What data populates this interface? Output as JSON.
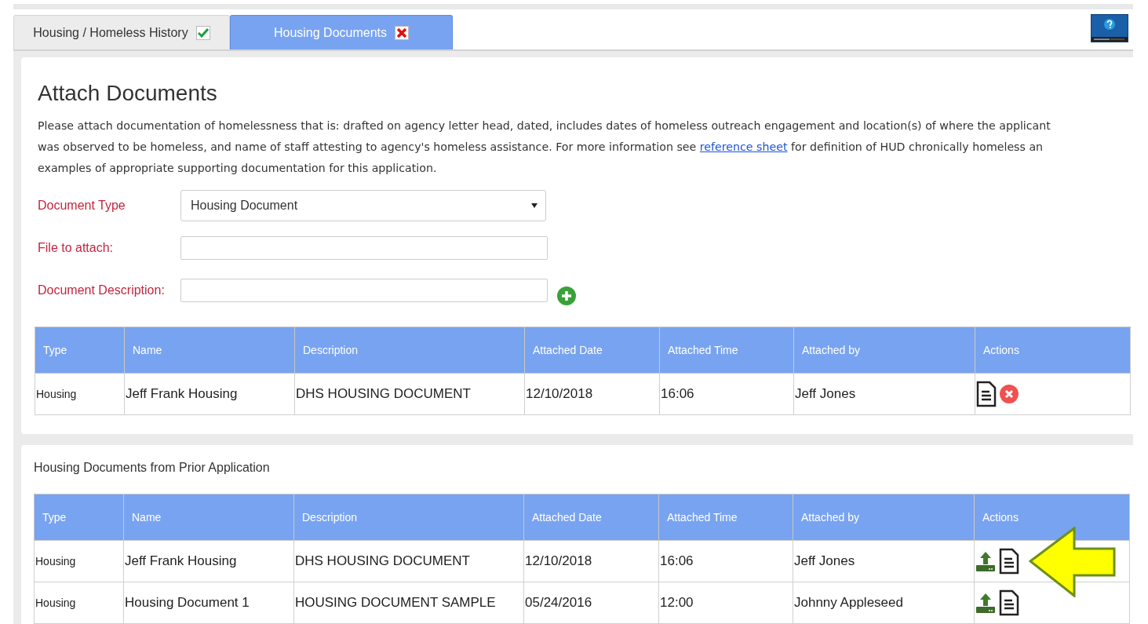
{
  "tabs": [
    {
      "label": "Housing / Homeless History",
      "selected": false,
      "complete": true
    },
    {
      "label": "Housing Documents",
      "selected": true,
      "complete": false
    }
  ],
  "attach": {
    "title": "Attach Documents",
    "intro_lines": [
      {
        "before": "Please attach documentation of homelessness that is: drafted on agency letter head, dated, includes dates of homeless outreach engagement and location(s) of where the applicant"
      },
      {
        "before": "was observed to be homeless, and name of staff attesting to agency's homeless assistance. For more information see ",
        "link": "reference sheet",
        "after": " for definition of HUD chronically homeless an"
      },
      {
        "before": "examples of appropriate supporting documentation for this application."
      }
    ],
    "form": [
      {
        "kind": "select",
        "label": "Document Type",
        "value": "Housing Document"
      },
      {
        "kind": "text",
        "label": "File to attach:"
      },
      {
        "kind": "add",
        "label": "Document Description:"
      }
    ],
    "table": {
      "columns": [
        "Type",
        "Name",
        "Description",
        "Attached Date",
        "Attached Time",
        "Attached by",
        "Actions"
      ],
      "rows": [
        {
          "cells": [
            "Housing",
            "Jeff Frank Housing",
            "DHS HOUSING DOCUMENT",
            "12/10/2018",
            "16:06",
            "Jeff Jones"
          ],
          "actions": [
            {
              "kind": "view"
            },
            {
              "kind": "delete"
            }
          ]
        }
      ]
    }
  },
  "prior": {
    "title": "Housing Documents from Prior Application",
    "table": {
      "columns": [
        "Type",
        "Name",
        "Description",
        "Attached Date",
        "Attached Time",
        "Attached by",
        "Actions"
      ],
      "rows": [
        {
          "cells": [
            "Housing",
            "Jeff Frank Housing",
            "DHS HOUSING DOCUMENT",
            "12/10/2018",
            "16:06",
            "Jeff Jones"
          ],
          "actions": [
            {
              "kind": "upload"
            },
            {
              "kind": "view"
            }
          ]
        },
        {
          "cells": [
            "Housing",
            "Housing Document 1",
            "HOUSING DOCUMENT SAMPLE",
            "05/24/2016",
            "12:00",
            "Johnny Appleseed"
          ],
          "actions": [
            {
              "kind": "upload"
            },
            {
              "kind": "view"
            }
          ]
        }
      ]
    }
  }
}
